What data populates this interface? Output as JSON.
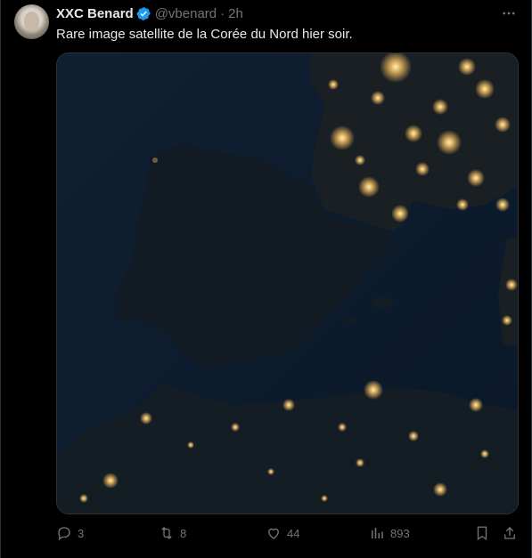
{
  "tweet": {
    "author_name": "XXC Benard",
    "author_handle": "@vbenard",
    "separator": "·",
    "time": "2h",
    "text": "Rare image satellite de la Corée du Nord hier soir.",
    "media_alt": "satellite-night-image"
  },
  "icons": {
    "verified": "verified-badge-icon",
    "more": "more-horizontal-icon",
    "reply": "reply-icon",
    "retweet": "retweet-icon",
    "like": "heart-icon",
    "views": "views-icon",
    "bookmark": "bookmark-icon",
    "share": "share-icon"
  },
  "stats": {
    "replies": "3",
    "retweets": "8",
    "likes": "44",
    "views": "893"
  },
  "colors": {
    "background": "#000000",
    "text_primary": "#e7e9ea",
    "text_secondary": "#71767b",
    "verified_blue": "#1d9bf0",
    "city_lights": "#ffc864"
  }
}
